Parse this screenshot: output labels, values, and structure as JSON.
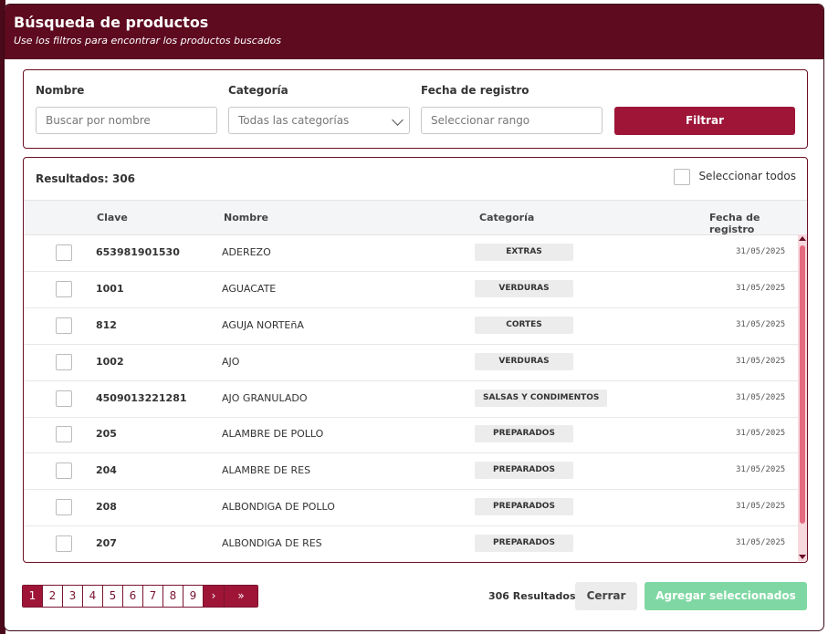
{
  "modal": {
    "title": "Búsqueda de productos",
    "subtitle": "Use los filtros para encontrar los productos buscados"
  },
  "filters": {
    "name_label": "Nombre",
    "name_placeholder": "Buscar por nombre",
    "category_label": "Categoría",
    "category_value": "Todas las categorías",
    "date_label": "Fecha de registro",
    "date_placeholder": "Seleccionar rango",
    "filter_button": "Filtrar"
  },
  "results": {
    "count_label": "Resultados: 306",
    "select_all": "Seleccionar todos",
    "columns": [
      "Clave",
      "Nombre",
      "Categoría",
      "Fecha de registro"
    ],
    "rows": [
      {
        "clave": "653981901530",
        "nombre": "ADEREZO",
        "categoria": "EXTRAS",
        "fecha": "31/05/2025"
      },
      {
        "clave": "1001",
        "nombre": "AGUACATE",
        "categoria": "VERDURAS",
        "fecha": "31/05/2025"
      },
      {
        "clave": "812",
        "nombre": "AGUJA NORTEñA",
        "categoria": "CORTES",
        "fecha": "31/05/2025"
      },
      {
        "clave": "1002",
        "nombre": "AJO",
        "categoria": "VERDURAS",
        "fecha": "31/05/2025"
      },
      {
        "clave": "4509013221281",
        "nombre": "AJO GRANULADO",
        "categoria": "SALSAS Y CONDIMENTOS",
        "fecha": "31/05/2025"
      },
      {
        "clave": "205",
        "nombre": "ALAMBRE DE POLLO",
        "categoria": "PREPARADOS",
        "fecha": "31/05/2025"
      },
      {
        "clave": "204",
        "nombre": "ALAMBRE DE RES",
        "categoria": "PREPARADOS",
        "fecha": "31/05/2025"
      },
      {
        "clave": "208",
        "nombre": "ALBONDIGA DE POLLO",
        "categoria": "PREPARADOS",
        "fecha": "31/05/2025"
      },
      {
        "clave": "207",
        "nombre": "ALBONDIGA DE RES",
        "categoria": "PREPARADOS",
        "fecha": "31/05/2025"
      }
    ]
  },
  "pagination": {
    "pages": [
      "1",
      "2",
      "3",
      "4",
      "5",
      "6",
      "7",
      "8",
      "9"
    ],
    "active_page": "1",
    "next": "›",
    "last": "»"
  },
  "footer": {
    "count": "306 Resultados",
    "close_button": "Cerrar",
    "add_button": "Agregar seleccionados"
  },
  "colors": {
    "header": "#5e0a1f",
    "primary": "#9e1538",
    "success_disabled": "#7fd8a3"
  }
}
